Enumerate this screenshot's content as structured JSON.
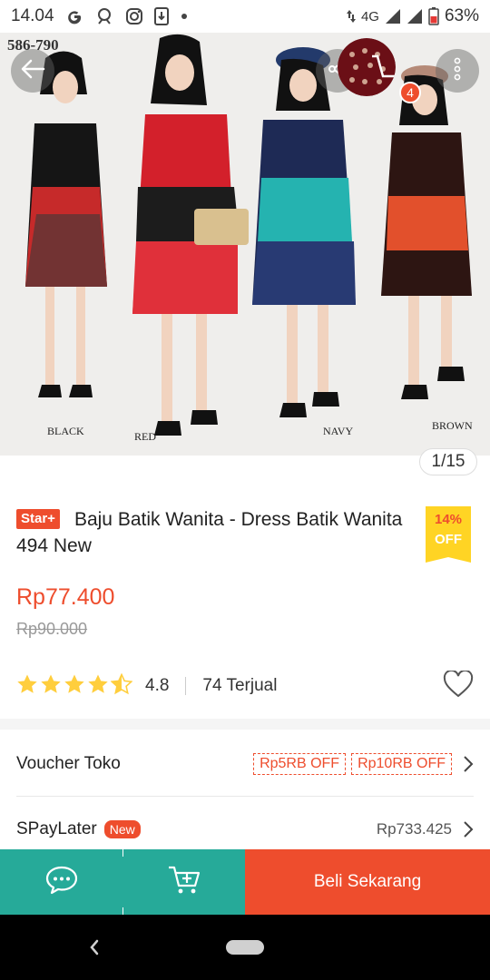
{
  "status_bar": {
    "time": "14.04",
    "network": "4G",
    "battery": "63%"
  },
  "hero": {
    "code_label": "586-790",
    "color_labels": [
      "BLACK",
      "RED",
      "NAVY",
      "BROWN"
    ],
    "cart_badge_count": "4",
    "page_indicator": "1/15"
  },
  "product": {
    "badge": "Star+",
    "title": "Baju Batik Wanita - Dress Batik Wanita 494 New",
    "discount_pct": "14%",
    "discount_label": "OFF",
    "price": "Rp77.400",
    "old_price": "Rp90.000",
    "rating": "4.8",
    "rating_stars": 4.5,
    "sold": "74 Terjual"
  },
  "voucher": {
    "label": "Voucher Toko",
    "tags": [
      "Rp5RB OFF",
      "Rp10RB OFF"
    ]
  },
  "spaylater": {
    "label": "SPayLater",
    "badge": "New",
    "amount": "Rp733.425"
  },
  "action_bar": {
    "buy_label": "Beli Sekarang"
  },
  "colors": {
    "brand": "#ee4d2d",
    "chat_green": "#26aa99",
    "star": "#ffce3d"
  }
}
